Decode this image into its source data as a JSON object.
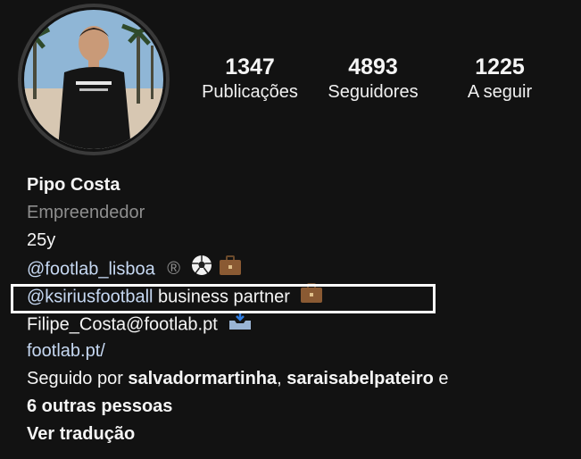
{
  "profile": {
    "stats": [
      {
        "number": "1347",
        "label": "Publicações"
      },
      {
        "number": "4893",
        "label": "Seguidores"
      },
      {
        "number": "1225",
        "label": "A seguir"
      }
    ],
    "name": "Pipo Costa",
    "category": "Empreendedor",
    "bio": {
      "age": "25y",
      "handle1": "@footlab_lisboa",
      "registered": "®",
      "handle2": "@ksiriusfootball",
      "handle2_suffix": " business partner",
      "email": "Filipe_Costa@footlab.pt",
      "website": "footlab.pt/"
    },
    "followed_by": {
      "prefix": "Seguido por ",
      "user1": "salvadormartinha",
      "separator": ", ",
      "user2": "saraisabelpateiro",
      "conjunction": " e",
      "others": "6 outras pessoas"
    },
    "translate_label": "Ver tradução"
  },
  "icons": {
    "soccer_ball": "soccer-ball-icon",
    "briefcase": "briefcase-icon",
    "inbox": "inbox-tray-icon"
  }
}
